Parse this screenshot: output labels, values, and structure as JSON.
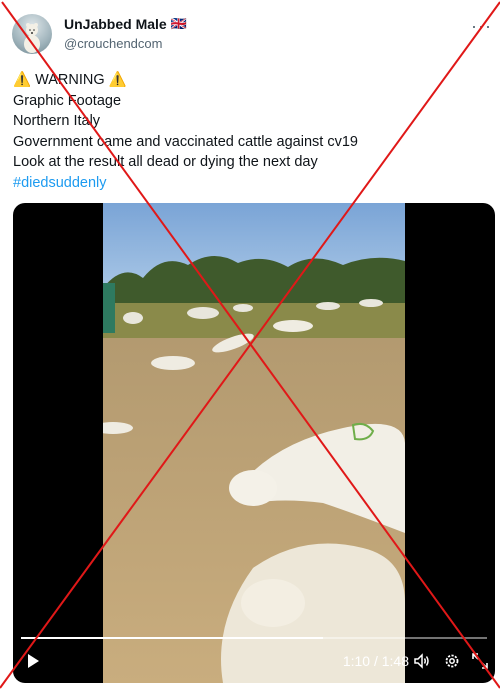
{
  "tweet": {
    "display_name": "UnJabbed Male",
    "flag": "🇬🇧",
    "handle": "@crouchendcom",
    "more_icon": "more-icon",
    "lines": [
      "⚠️ WARNING ⚠️",
      "Graphic Footage",
      "Northern Italy",
      "Government came and vaccinated cattle against cv19",
      "Look at the result all dead or dying the next day"
    ],
    "hashtag": "#diedsuddenly"
  },
  "video": {
    "time": "1:10 / 1:48",
    "progress": 0.648,
    "icons": [
      "play-icon",
      "volume-icon",
      "settings-gear-icon",
      "fullscreen-icon"
    ]
  },
  "overlay": {
    "icon": "red-x-mark",
    "color": "#e01818"
  }
}
